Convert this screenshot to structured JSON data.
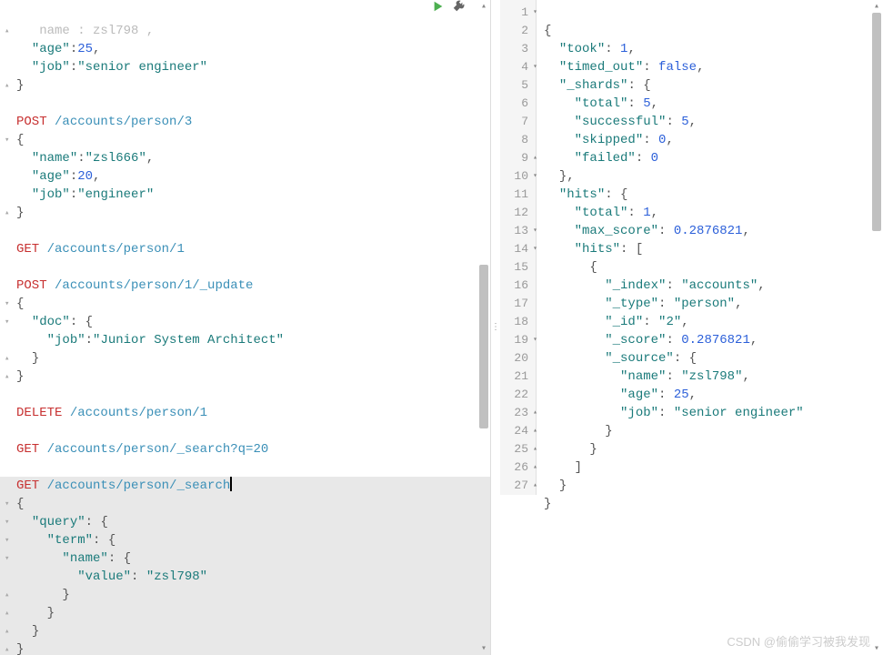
{
  "left": {
    "req1_url": "/accounts/person/3",
    "req1_body_name": "zsl666",
    "req1_body_age": 20,
    "req1_body_job": "engineer",
    "head_name_key": "name",
    "head_name_val": "zsl798",
    "head_age": 25,
    "head_job": "senior engineer",
    "req2_method": "GET",
    "req2_url": "/accounts/person/1",
    "req3_method": "POST",
    "req3_url": "/accounts/person/1/_update",
    "req3_job": "Junior System Architect",
    "req4_method": "DELETE",
    "req4_url": "/accounts/person/1",
    "req5_method": "GET",
    "req5_url": "/accounts/person/_search?q=20",
    "active_method": "GET",
    "active_url": "/accounts/person/_search",
    "query_value": "zsl798"
  },
  "right": {
    "took": 1,
    "timed_out": "false",
    "shards_total": 5,
    "shards_successful": 5,
    "shards_skipped": 0,
    "shards_failed": 0,
    "hits_total": 1,
    "max_score": 0.2876821,
    "hit_index": "accounts",
    "hit_type": "person",
    "hit_id": "2",
    "hit_score": 0.2876821,
    "src_name": "zsl798",
    "src_age": 25,
    "src_job": "senior engineer"
  },
  "watermark": "CSDN @偷偷学习被我发现"
}
